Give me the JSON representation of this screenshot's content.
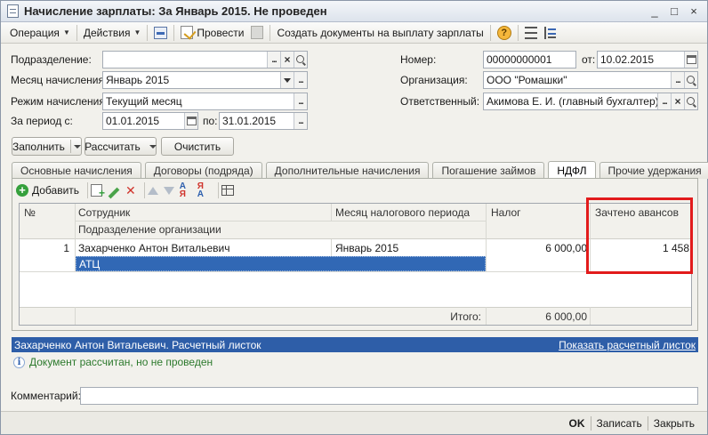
{
  "window": {
    "title": "Начисление зарплаты: За Январь 2015. Не проведен",
    "buttons": [
      "_",
      "□",
      "×"
    ]
  },
  "toolbar": {
    "operation": "Операция",
    "actions": "Действия",
    "conduct": "Провести",
    "create_docs": "Создать документы на выплату зарплаты"
  },
  "form": {
    "division_label": "Подразделение:",
    "division_value": "",
    "month_label": "Месяц начисления:",
    "month_value": "Январь 2015",
    "mode_label": "Режим начисления:",
    "mode_value": "Текущий месяц",
    "period_label": "За период с:",
    "period_from": "01.01.2015",
    "period_to_label": "по:",
    "period_to": "31.01.2015",
    "number_label": "Номер:",
    "number_value": "00000000001",
    "date_label": "от:",
    "date_value": "10.02.2015",
    "org_label": "Организация:",
    "org_value": "ООО \"Ромашки\"",
    "resp_label": "Ответственный:",
    "resp_value": "Акимова Е. И. (главный бухгалтер)"
  },
  "buttons": {
    "fill": "Заполнить",
    "calculate": "Рассчитать",
    "clear": "Очистить"
  },
  "tabs": [
    {
      "label": "Основные начисления"
    },
    {
      "label": "Договоры (подряда)"
    },
    {
      "label": "Дополнительные начисления"
    },
    {
      "label": "Погашение займов"
    },
    {
      "label": "НДФЛ"
    },
    {
      "label": "Прочие удержания"
    }
  ],
  "panel": {
    "add": "Добавить"
  },
  "table": {
    "headers": {
      "num": "№",
      "employee": "Сотрудник",
      "division": "Подразделение организации",
      "tax_month": "Месяц налогового периода",
      "tax": "Налог",
      "advances": "Зачтено авансов"
    },
    "rows": [
      {
        "num": "1",
        "employee": "Захарченко Антон Витальевич",
        "division": "АТЦ",
        "tax_month": "Январь 2015",
        "tax": "6 000,00",
        "advances": "1 458"
      }
    ],
    "total_label": "Итого:",
    "total_tax": "6 000,00"
  },
  "status": {
    "text": "Захарченко Антон Витальевич. Расчетный листок",
    "link": "Показать расчетный листок"
  },
  "info": "Документ рассчитан, но не проведен",
  "comment": {
    "label": "Комментарий:",
    "value": ""
  },
  "footer": {
    "ok": "OK",
    "save": "Записать",
    "close": "Закрыть"
  }
}
